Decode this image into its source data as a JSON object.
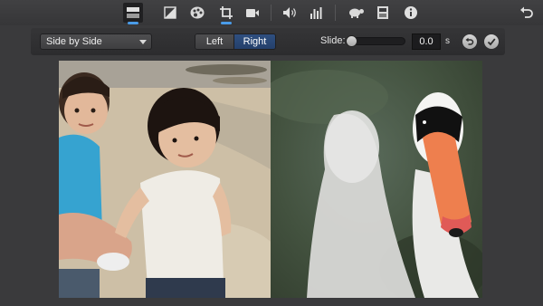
{
  "toolbar": {
    "tools": [
      {
        "icon": "video-overlay-settings-icon",
        "active": true
      },
      {
        "icon": "color-balance-icon"
      },
      {
        "icon": "color-correction-icon"
      },
      {
        "icon": "crop-icon",
        "active": true
      },
      {
        "icon": "stabilization-icon"
      },
      {
        "icon": "volume-icon"
      },
      {
        "icon": "noise-reduction-equalizer-icon"
      },
      {
        "icon": "speed-icon"
      },
      {
        "icon": "clip-filter-icon"
      },
      {
        "icon": "clip-info-icon"
      },
      {
        "icon": "reset-all-icon"
      }
    ]
  },
  "overlay_controls": {
    "style_selected": "Side by Side",
    "position_options": [
      "Left",
      "Right"
    ],
    "position_selected": "Right",
    "slide_label": "Slide:",
    "slide_value": "0.0",
    "slide_unit": "s",
    "slide_level": 0
  },
  "viewer": {
    "left_content": "children-on-beach-photo",
    "right_content": "swan-photo"
  },
  "colors": {
    "accent": "#4a9be8",
    "segment_selected": "#2f4f80",
    "background": "#3a3a3c"
  }
}
